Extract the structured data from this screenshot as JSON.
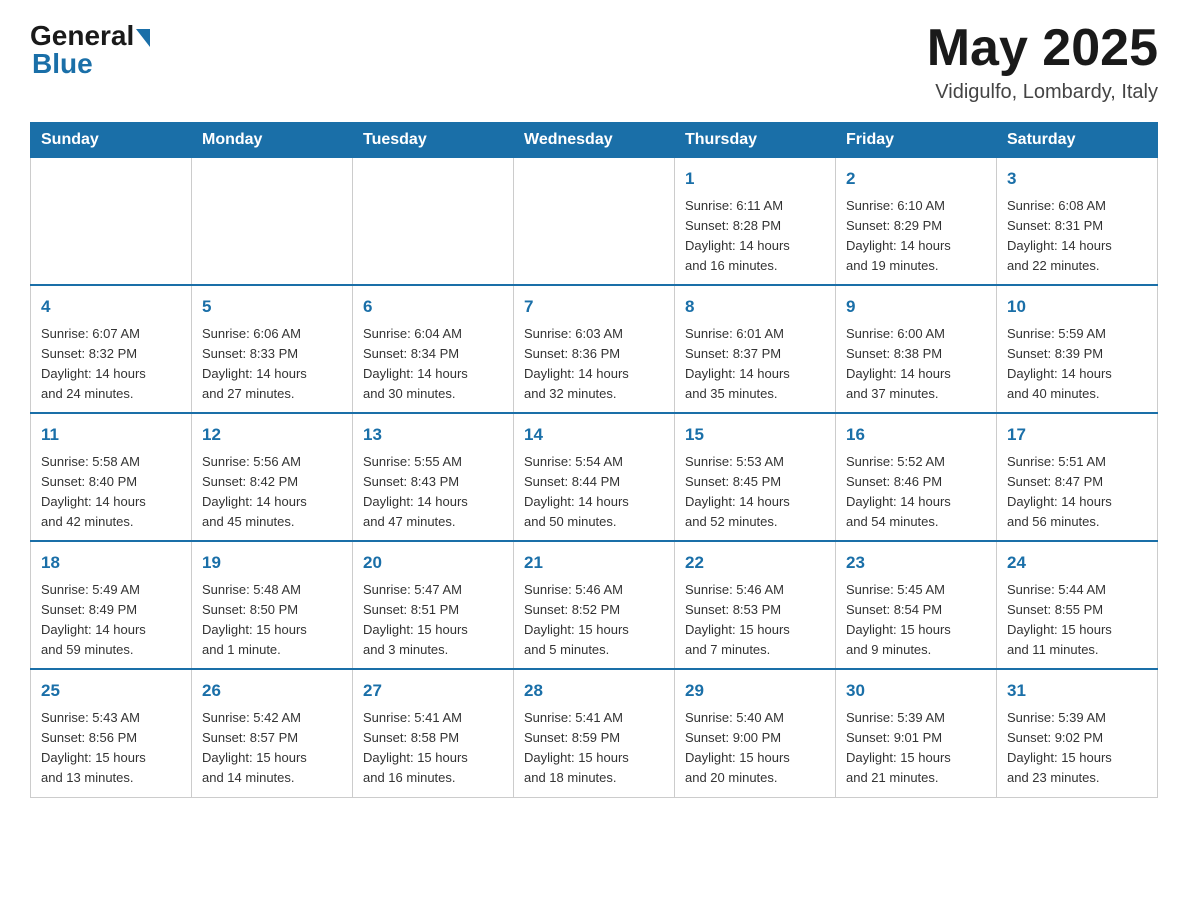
{
  "header": {
    "logo_general": "General",
    "logo_blue": "Blue",
    "month_title": "May 2025",
    "location": "Vidigulfo, Lombardy, Italy"
  },
  "weekdays": [
    "Sunday",
    "Monday",
    "Tuesday",
    "Wednesday",
    "Thursday",
    "Friday",
    "Saturday"
  ],
  "weeks": [
    [
      {
        "day": "",
        "info": ""
      },
      {
        "day": "",
        "info": ""
      },
      {
        "day": "",
        "info": ""
      },
      {
        "day": "",
        "info": ""
      },
      {
        "day": "1",
        "info": "Sunrise: 6:11 AM\nSunset: 8:28 PM\nDaylight: 14 hours\nand 16 minutes."
      },
      {
        "day": "2",
        "info": "Sunrise: 6:10 AM\nSunset: 8:29 PM\nDaylight: 14 hours\nand 19 minutes."
      },
      {
        "day": "3",
        "info": "Sunrise: 6:08 AM\nSunset: 8:31 PM\nDaylight: 14 hours\nand 22 minutes."
      }
    ],
    [
      {
        "day": "4",
        "info": "Sunrise: 6:07 AM\nSunset: 8:32 PM\nDaylight: 14 hours\nand 24 minutes."
      },
      {
        "day": "5",
        "info": "Sunrise: 6:06 AM\nSunset: 8:33 PM\nDaylight: 14 hours\nand 27 minutes."
      },
      {
        "day": "6",
        "info": "Sunrise: 6:04 AM\nSunset: 8:34 PM\nDaylight: 14 hours\nand 30 minutes."
      },
      {
        "day": "7",
        "info": "Sunrise: 6:03 AM\nSunset: 8:36 PM\nDaylight: 14 hours\nand 32 minutes."
      },
      {
        "day": "8",
        "info": "Sunrise: 6:01 AM\nSunset: 8:37 PM\nDaylight: 14 hours\nand 35 minutes."
      },
      {
        "day": "9",
        "info": "Sunrise: 6:00 AM\nSunset: 8:38 PM\nDaylight: 14 hours\nand 37 minutes."
      },
      {
        "day": "10",
        "info": "Sunrise: 5:59 AM\nSunset: 8:39 PM\nDaylight: 14 hours\nand 40 minutes."
      }
    ],
    [
      {
        "day": "11",
        "info": "Sunrise: 5:58 AM\nSunset: 8:40 PM\nDaylight: 14 hours\nand 42 minutes."
      },
      {
        "day": "12",
        "info": "Sunrise: 5:56 AM\nSunset: 8:42 PM\nDaylight: 14 hours\nand 45 minutes."
      },
      {
        "day": "13",
        "info": "Sunrise: 5:55 AM\nSunset: 8:43 PM\nDaylight: 14 hours\nand 47 minutes."
      },
      {
        "day": "14",
        "info": "Sunrise: 5:54 AM\nSunset: 8:44 PM\nDaylight: 14 hours\nand 50 minutes."
      },
      {
        "day": "15",
        "info": "Sunrise: 5:53 AM\nSunset: 8:45 PM\nDaylight: 14 hours\nand 52 minutes."
      },
      {
        "day": "16",
        "info": "Sunrise: 5:52 AM\nSunset: 8:46 PM\nDaylight: 14 hours\nand 54 minutes."
      },
      {
        "day": "17",
        "info": "Sunrise: 5:51 AM\nSunset: 8:47 PM\nDaylight: 14 hours\nand 56 minutes."
      }
    ],
    [
      {
        "day": "18",
        "info": "Sunrise: 5:49 AM\nSunset: 8:49 PM\nDaylight: 14 hours\nand 59 minutes."
      },
      {
        "day": "19",
        "info": "Sunrise: 5:48 AM\nSunset: 8:50 PM\nDaylight: 15 hours\nand 1 minute."
      },
      {
        "day": "20",
        "info": "Sunrise: 5:47 AM\nSunset: 8:51 PM\nDaylight: 15 hours\nand 3 minutes."
      },
      {
        "day": "21",
        "info": "Sunrise: 5:46 AM\nSunset: 8:52 PM\nDaylight: 15 hours\nand 5 minutes."
      },
      {
        "day": "22",
        "info": "Sunrise: 5:46 AM\nSunset: 8:53 PM\nDaylight: 15 hours\nand 7 minutes."
      },
      {
        "day": "23",
        "info": "Sunrise: 5:45 AM\nSunset: 8:54 PM\nDaylight: 15 hours\nand 9 minutes."
      },
      {
        "day": "24",
        "info": "Sunrise: 5:44 AM\nSunset: 8:55 PM\nDaylight: 15 hours\nand 11 minutes."
      }
    ],
    [
      {
        "day": "25",
        "info": "Sunrise: 5:43 AM\nSunset: 8:56 PM\nDaylight: 15 hours\nand 13 minutes."
      },
      {
        "day": "26",
        "info": "Sunrise: 5:42 AM\nSunset: 8:57 PM\nDaylight: 15 hours\nand 14 minutes."
      },
      {
        "day": "27",
        "info": "Sunrise: 5:41 AM\nSunset: 8:58 PM\nDaylight: 15 hours\nand 16 minutes."
      },
      {
        "day": "28",
        "info": "Sunrise: 5:41 AM\nSunset: 8:59 PM\nDaylight: 15 hours\nand 18 minutes."
      },
      {
        "day": "29",
        "info": "Sunrise: 5:40 AM\nSunset: 9:00 PM\nDaylight: 15 hours\nand 20 minutes."
      },
      {
        "day": "30",
        "info": "Sunrise: 5:39 AM\nSunset: 9:01 PM\nDaylight: 15 hours\nand 21 minutes."
      },
      {
        "day": "31",
        "info": "Sunrise: 5:39 AM\nSunset: 9:02 PM\nDaylight: 15 hours\nand 23 minutes."
      }
    ]
  ]
}
